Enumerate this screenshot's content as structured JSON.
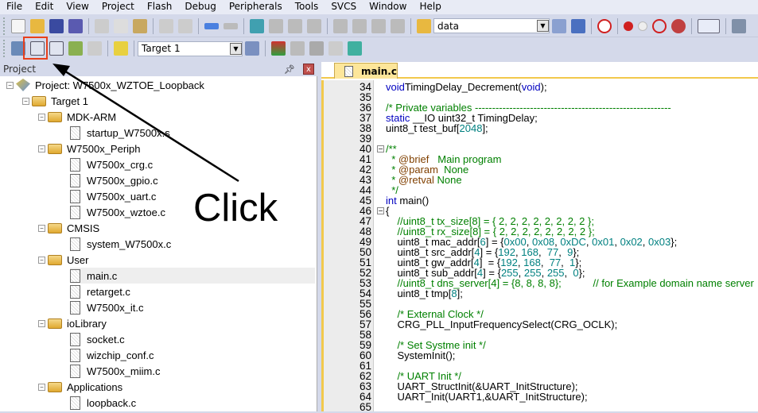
{
  "menu": [
    "File",
    "Edit",
    "View",
    "Project",
    "Flash",
    "Debug",
    "Peripherals",
    "Tools",
    "SVCS",
    "Window",
    "Help"
  ],
  "toolbar1": {
    "find_combo": "data"
  },
  "toolbar2": {
    "target_combo": "Target 1"
  },
  "project_panel": {
    "title": "Project",
    "pin": "ȣ",
    "close": "x"
  },
  "tree": [
    {
      "level": 0,
      "type": "project",
      "label": "Project: W7500x_WZTOE_Loopback",
      "toggle": "-"
    },
    {
      "level": 1,
      "type": "folder",
      "label": "Target 1",
      "toggle": "-"
    },
    {
      "level": 2,
      "type": "folder",
      "label": "MDK-ARM",
      "toggle": "-"
    },
    {
      "level": 3,
      "type": "file",
      "label": "startup_W7500x.s"
    },
    {
      "level": 2,
      "type": "folder",
      "label": "W7500x_Periph",
      "toggle": "-"
    },
    {
      "level": 3,
      "type": "file",
      "label": "W7500x_crg.c"
    },
    {
      "level": 3,
      "type": "file",
      "label": "W7500x_gpio.c"
    },
    {
      "level": 3,
      "type": "file",
      "label": "W7500x_uart.c"
    },
    {
      "level": 3,
      "type": "file",
      "label": "W7500x_wztoe.c"
    },
    {
      "level": 2,
      "type": "folder",
      "label": "CMSIS",
      "toggle": "-"
    },
    {
      "level": 3,
      "type": "file",
      "label": "system_W7500x.c"
    },
    {
      "level": 2,
      "type": "folder",
      "label": "User",
      "toggle": "-"
    },
    {
      "level": 3,
      "type": "file",
      "label": "main.c",
      "selected": true
    },
    {
      "level": 3,
      "type": "file",
      "label": "retarget.c"
    },
    {
      "level": 3,
      "type": "file",
      "label": "W7500x_it.c"
    },
    {
      "level": 2,
      "type": "folder",
      "label": "ioLibrary",
      "toggle": "-"
    },
    {
      "level": 3,
      "type": "file",
      "label": "socket.c"
    },
    {
      "level": 3,
      "type": "file",
      "label": "wizchip_conf.c"
    },
    {
      "level": 3,
      "type": "file",
      "label": "W7500x_miim.c"
    },
    {
      "level": 2,
      "type": "folder",
      "label": "Applications",
      "toggle": "-"
    },
    {
      "level": 3,
      "type": "file",
      "label": "loopback.c"
    }
  ],
  "editor": {
    "tab": "main.c",
    "lines": [
      {
        "n": "34",
        "s": [
          [
            "kw",
            "void"
          ],
          [
            "",
            "TimingDelay_Decrement("
          ],
          [
            "kw",
            "void"
          ],
          [
            "",
            ");"
          ]
        ]
      },
      {
        "n": "35",
        "s": []
      },
      {
        "n": "36",
        "s": [
          [
            "cm",
            "/* Private variables ---------------------------------------------------------"
          ]
        ]
      },
      {
        "n": "37",
        "s": [
          [
            "kw",
            "static"
          ],
          [
            "",
            " __IO uint32_t TimingDelay;"
          ]
        ]
      },
      {
        "n": "38",
        "s": [
          [
            "",
            "uint8_t test_buf["
          ],
          [
            "nu",
            "2048"
          ],
          [
            "",
            "];"
          ]
        ]
      },
      {
        "n": "39",
        "s": []
      },
      {
        "n": "40",
        "s": [
          [
            "cm",
            "/**"
          ]
        ],
        "fold": "-"
      },
      {
        "n": "41",
        "s": [
          [
            "cm",
            "  * "
          ],
          [
            "dt",
            "@brief"
          ],
          [
            "cm",
            "   Main program"
          ]
        ]
      },
      {
        "n": "42",
        "s": [
          [
            "cm",
            "  * "
          ],
          [
            "dt",
            "@param"
          ],
          [
            "cm",
            "  None"
          ]
        ]
      },
      {
        "n": "43",
        "s": [
          [
            "cm",
            "  * "
          ],
          [
            "dt",
            "@retval"
          ],
          [
            "cm",
            " None"
          ]
        ]
      },
      {
        "n": "44",
        "s": [
          [
            "cm",
            "  */"
          ]
        ]
      },
      {
        "n": "45",
        "s": [
          [
            "kw",
            "int"
          ],
          [
            "",
            " main()"
          ]
        ]
      },
      {
        "n": "46",
        "s": [
          [
            "",
            "{"
          ]
        ],
        "fold": "-"
      },
      {
        "n": "47",
        "s": [
          [
            "cm",
            "    //uint8_t tx_size[8] = { 2, 2, 2, 2, 2, 2, 2, 2 };"
          ]
        ]
      },
      {
        "n": "48",
        "s": [
          [
            "cm",
            "    //uint8_t rx_size[8] = { 2, 2, 2, 2, 2, 2, 2, 2 };"
          ]
        ]
      },
      {
        "n": "49",
        "s": [
          [
            "",
            "    uint8_t mac_addr["
          ],
          [
            "nu",
            "6"
          ],
          [
            "",
            "] = {"
          ],
          [
            "nu",
            "0x00"
          ],
          [
            "",
            ", "
          ],
          [
            "nu",
            "0x08"
          ],
          [
            "",
            ", "
          ],
          [
            "nu",
            "0xDC"
          ],
          [
            "",
            ", "
          ],
          [
            "nu",
            "0x01"
          ],
          [
            "",
            ", "
          ],
          [
            "nu",
            "0x02"
          ],
          [
            "",
            ", "
          ],
          [
            "nu",
            "0x03"
          ],
          [
            "",
            "};"
          ]
        ]
      },
      {
        "n": "50",
        "s": [
          [
            "",
            "    uint8_t src_addr["
          ],
          [
            "nu",
            "4"
          ],
          [
            "",
            "] = {"
          ],
          [
            "nu",
            "192"
          ],
          [
            "",
            ", "
          ],
          [
            "nu",
            "168"
          ],
          [
            "",
            ",  "
          ],
          [
            "nu",
            "77"
          ],
          [
            "",
            ",  "
          ],
          [
            "nu",
            "9"
          ],
          [
            "",
            "};"
          ]
        ]
      },
      {
        "n": "51",
        "s": [
          [
            "",
            "    uint8_t gw_addr["
          ],
          [
            "nu",
            "4"
          ],
          [
            "",
            "]  = {"
          ],
          [
            "nu",
            "192"
          ],
          [
            "",
            ", "
          ],
          [
            "nu",
            "168"
          ],
          [
            "",
            ",  "
          ],
          [
            "nu",
            "77"
          ],
          [
            "",
            ",  "
          ],
          [
            "nu",
            "1"
          ],
          [
            "",
            "};"
          ]
        ]
      },
      {
        "n": "52",
        "s": [
          [
            "",
            "    uint8_t sub_addr["
          ],
          [
            "nu",
            "4"
          ],
          [
            "",
            "] = {"
          ],
          [
            "nu",
            "255"
          ],
          [
            "",
            ", "
          ],
          [
            "nu",
            "255"
          ],
          [
            "",
            ", "
          ],
          [
            "nu",
            "255"
          ],
          [
            "",
            ",  "
          ],
          [
            "nu",
            "0"
          ],
          [
            "",
            "};"
          ]
        ]
      },
      {
        "n": "53",
        "s": [
          [
            "cm",
            "    //uint8_t dns_server[4] = {8, 8, 8, 8};           // for Example domain name server"
          ]
        ]
      },
      {
        "n": "54",
        "s": [
          [
            "",
            "    uint8_t tmp["
          ],
          [
            "nu",
            "8"
          ],
          [
            "",
            "];"
          ]
        ]
      },
      {
        "n": "55",
        "s": []
      },
      {
        "n": "56",
        "s": [
          [
            "cm",
            "    /* External Clock */"
          ]
        ]
      },
      {
        "n": "57",
        "s": [
          [
            "",
            "    CRG_PLL_InputFrequencySelect(CRG_OCLK);"
          ]
        ]
      },
      {
        "n": "58",
        "s": []
      },
      {
        "n": "59",
        "s": [
          [
            "cm",
            "    /* Set Systme init */"
          ]
        ]
      },
      {
        "n": "60",
        "s": [
          [
            "",
            "    SystemInit();"
          ]
        ]
      },
      {
        "n": "61",
        "s": []
      },
      {
        "n": "62",
        "s": [
          [
            "cm",
            "    /* UART Init */"
          ]
        ]
      },
      {
        "n": "63",
        "s": [
          [
            "",
            "    UART_StructInit(&UART_InitStructure);"
          ]
        ]
      },
      {
        "n": "64",
        "s": [
          [
            "",
            "    UART_Init(UART1,&UART_InitStructure);"
          ]
        ]
      },
      {
        "n": "65",
        "s": []
      }
    ]
  },
  "annotation": {
    "text": "Click",
    "color": "#000000"
  },
  "colors": {
    "highlight_box": "#e8401c",
    "keyword": "#0000c0",
    "comment": "#008000",
    "number": "#008080",
    "doc_tag": "#804000"
  }
}
